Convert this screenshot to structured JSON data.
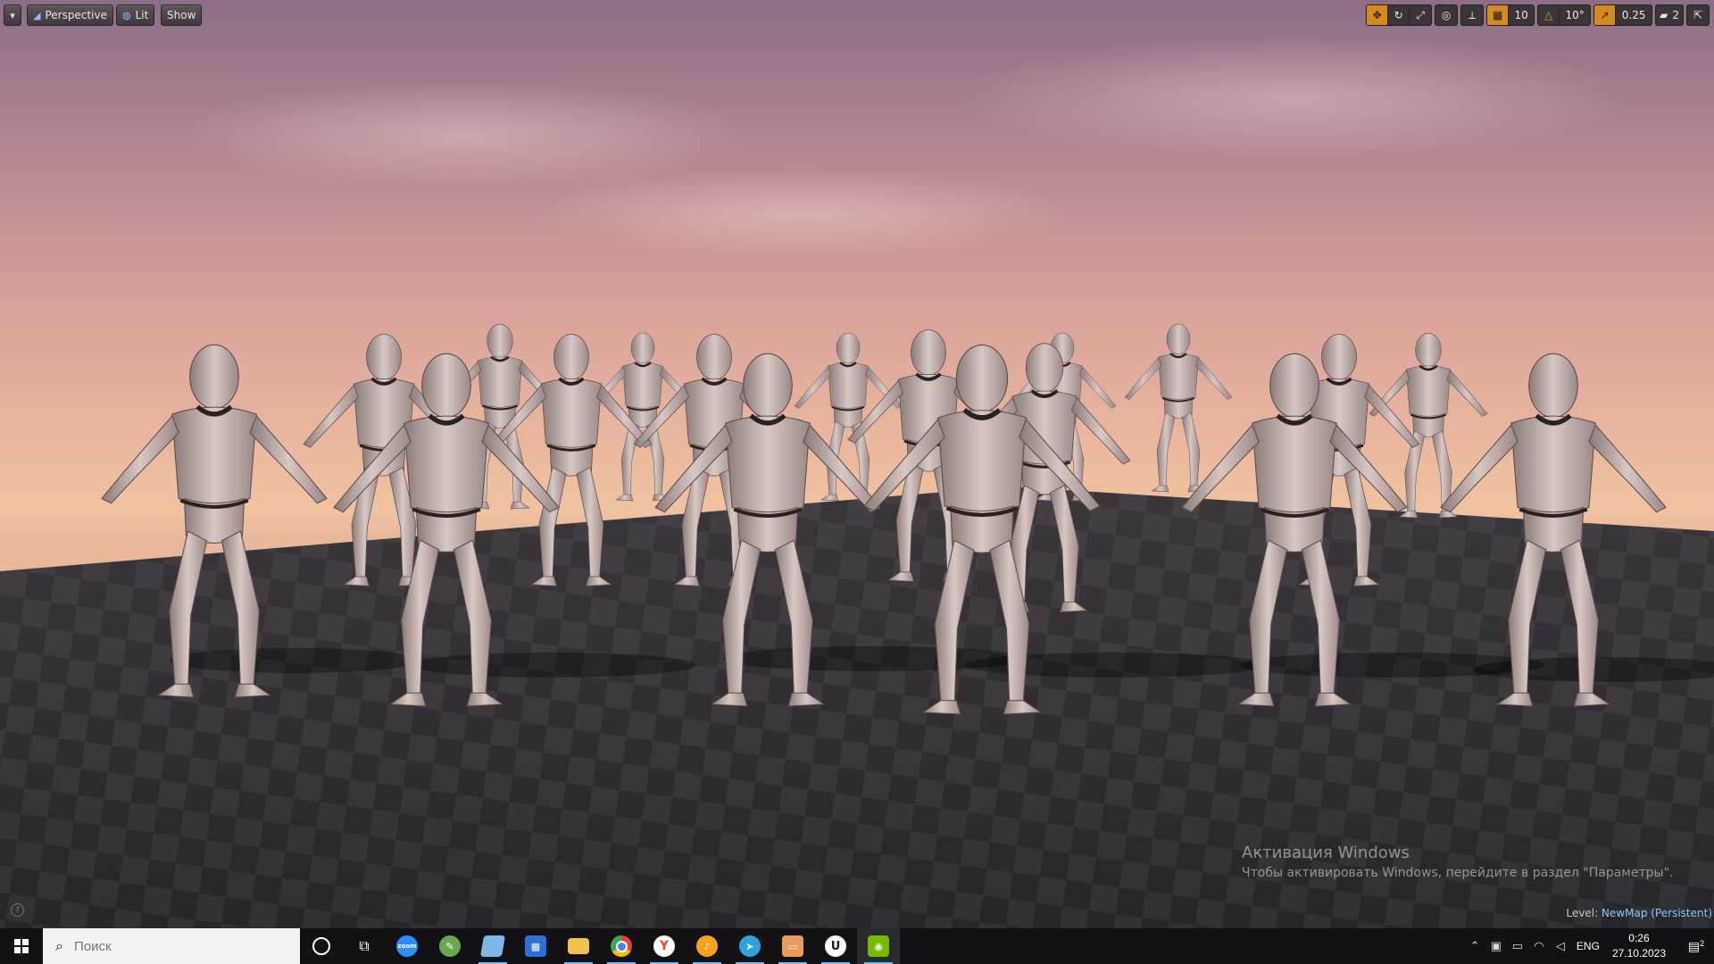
{
  "viewport": {
    "options_menu_icon": "chevron-down-icon",
    "perspective_label": "Perspective",
    "lit_label": "Lit",
    "show_label": "Show",
    "grid_snap_value": "10",
    "rotation_snap_value": "10°",
    "scale_snap_value": "0.25",
    "camera_speed_value": "2",
    "level_prefix": "Level:",
    "level_name": "NewMap (Persistent)"
  },
  "watermark": {
    "title": "Активация Windows",
    "subtitle": "Чтобы активировать Windows, перейдите в раздел \"Параметры\"."
  },
  "taskbar": {
    "search_placeholder": "Поиск",
    "apps": [
      {
        "name": "cortana",
        "icon": "circle-icon"
      },
      {
        "name": "task-view",
        "icon": "task-view-icon"
      },
      {
        "name": "zoom",
        "icon": "zoom-icon",
        "label": "zoom",
        "color": "#2d8cff"
      },
      {
        "name": "paint",
        "icon": "palette-icon",
        "color": "#6aa84f"
      },
      {
        "name": "notepad",
        "icon": "notepad-icon",
        "color": "#7fb6e8"
      },
      {
        "name": "calendar-app",
        "icon": "grid-app-icon",
        "color": "#2f6fd6"
      },
      {
        "name": "file-explorer",
        "icon": "folder-icon",
        "color": "#f2c14e"
      },
      {
        "name": "chrome",
        "icon": "chrome-icon",
        "color": "#e94235"
      },
      {
        "name": "yandex",
        "icon": "yandex-icon",
        "label": "Y",
        "color": "#fc3f1d"
      },
      {
        "name": "music-player",
        "icon": "music-icon",
        "color": "#f7a21b"
      },
      {
        "name": "telegram",
        "icon": "telegram-icon",
        "color": "#2aa3e0"
      },
      {
        "name": "image-viewer",
        "icon": "image-icon",
        "color": "#e89b5b"
      },
      {
        "name": "unreal-engine",
        "icon": "unreal-icon",
        "label": "U",
        "color": "#1b1b1b"
      },
      {
        "name": "nvidia",
        "icon": "nvidia-icon",
        "color": "#76b900"
      }
    ],
    "tray": {
      "language": "ENG",
      "time": "0:26",
      "date": "27.10.2023",
      "notification_count": "2"
    }
  }
}
